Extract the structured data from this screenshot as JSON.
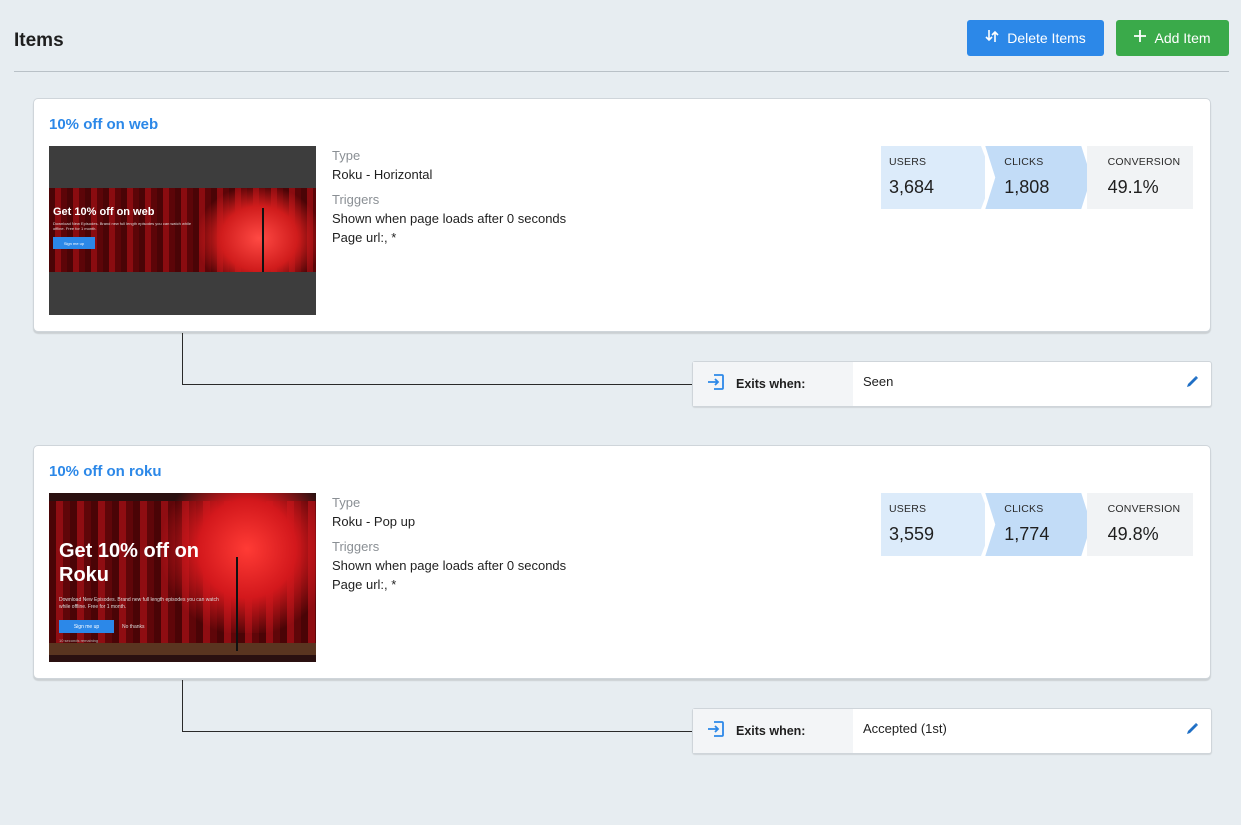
{
  "header": {
    "title": "Items",
    "delete_label": "Delete Items",
    "add_label": "Add Item"
  },
  "items": [
    {
      "title": "10% off on web",
      "thumbnail": {
        "headline": "Get 10% off on web",
        "subtext": "Download New Episodes. Brand new full length episodes you can watch while offline. Free for 1 month.",
        "cta": "Sign me up"
      },
      "type_label": "Type",
      "type_value": "Roku - Horizontal",
      "triggers_label": "Triggers",
      "trigger_line": "Shown when page loads after 0 seconds",
      "page_url": "Page url:, *",
      "stats": {
        "users_label": "USERS",
        "users": "3,684",
        "clicks_label": "CLICKS",
        "clicks": "1,808",
        "conversion_label": "CONVERSION",
        "conversion": "49.1%"
      },
      "exit": {
        "label": "Exits when:",
        "value": "Seen"
      }
    },
    {
      "title": "10% off on roku",
      "thumbnail": {
        "headline": "Get 10% off on Roku",
        "subtext": "Download New Episodes. Brand new full length episodes you can watch while offline. Free for 1 month.",
        "cta": "Sign me up",
        "secondary": "No thanks",
        "remaining": "10 seconds remaining"
      },
      "type_label": "Type",
      "type_value": "Roku - Pop up",
      "triggers_label": "Triggers",
      "trigger_line": "Shown when page loads after 0 seconds",
      "page_url": "Page url:, *",
      "stats": {
        "users_label": "USERS",
        "users": "3,559",
        "clicks_label": "CLICKS",
        "clicks": "1,774",
        "conversion_label": "CONVERSION",
        "conversion": "49.8%"
      },
      "exit": {
        "label": "Exits when:",
        "value": "Accepted (1st)"
      }
    }
  ],
  "colors": {
    "accent": "#2c88e8",
    "add": "#3aaa4a",
    "users_bg": "#dcebfa",
    "clicks_bg": "#c2dcf7",
    "conversion_bg": "#f1f3f5"
  },
  "icons": [
    "sort-arrows-icon",
    "plus-icon",
    "exit-icon",
    "pencil-icon"
  ]
}
